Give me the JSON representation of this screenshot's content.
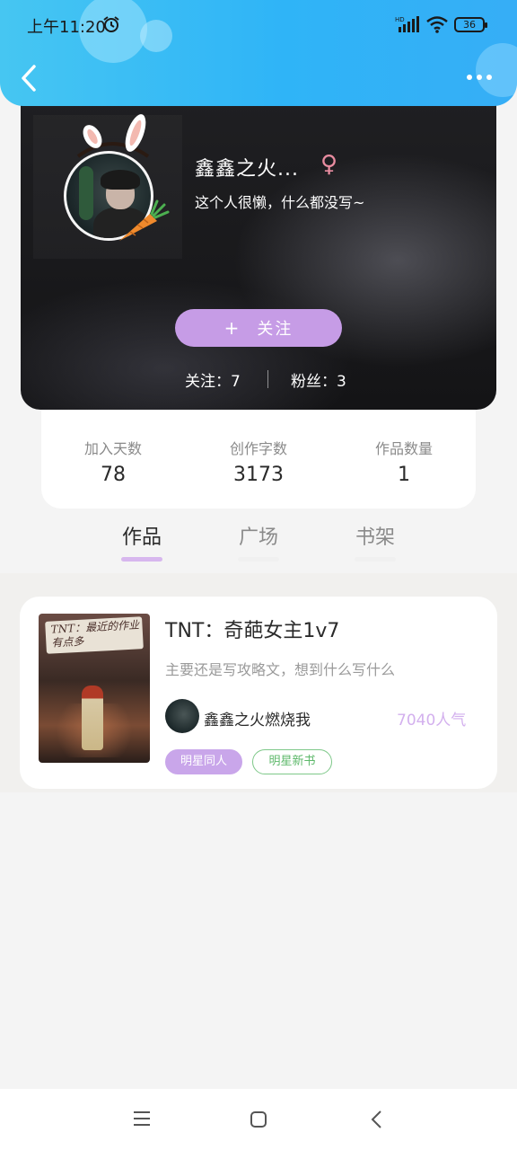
{
  "status_bar": {
    "time": "上午11:20",
    "battery": "36"
  },
  "profile": {
    "nickname": "鑫鑫之火...",
    "gender_symbol": "♀",
    "bio": "这个人很懒，什么都没写~",
    "follow_plus": "+",
    "follow_label": "关注",
    "following": "关注：7",
    "fans": "粉丝：3"
  },
  "stats": [
    {
      "label": "加入天数",
      "value": "78"
    },
    {
      "label": "创作字数",
      "value": "3173"
    },
    {
      "label": "作品数量",
      "value": "1"
    }
  ],
  "tabs": [
    {
      "label": "作品",
      "active": true
    },
    {
      "label": "广场",
      "active": false
    },
    {
      "label": "书架",
      "active": false
    }
  ],
  "work": {
    "title": "TNT：奇葩女主1v7",
    "description": "主要还是写攻略文，想到什么写什么",
    "author": "鑫鑫之火燃烧我",
    "popularity": "7040人气",
    "cover_text": "TNT：最近的作业有点多",
    "tags": [
      "明星同人",
      "明星新书"
    ]
  },
  "colors": {
    "header_gradient_start": "#46c6f2",
    "header_gradient_end": "#36aef6",
    "accent_purple": "#c69ce6",
    "tag_green": "#5db86a",
    "gender_pink": "#e88ca0"
  },
  "icons": {
    "back": "chevron-left-icon",
    "more": "more-dots-icon",
    "alarm": "alarm-clock-icon",
    "signal": "signal-icon",
    "wifi": "wifi-icon",
    "nav_menu": "menu-icon",
    "nav_home": "home-square-icon",
    "nav_back": "back-chevron-icon"
  }
}
